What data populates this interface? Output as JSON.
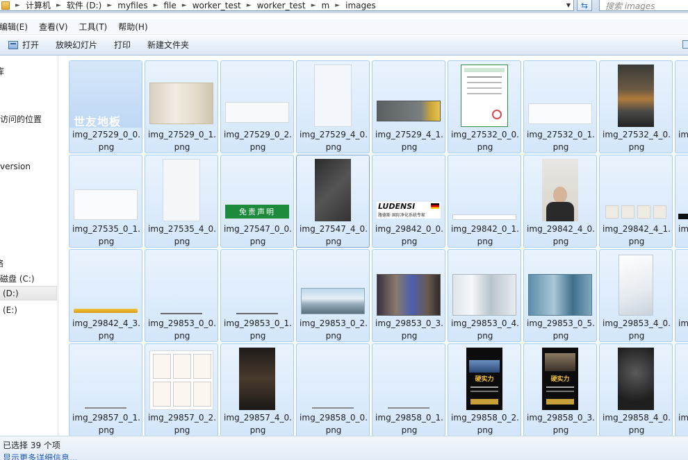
{
  "address_bar": {
    "crumbs": [
      "计算机",
      "软件 (D:)",
      "myfiles",
      "file",
      "worker_test",
      "worker_test",
      "m",
      "images"
    ],
    "search_placeholder": "搜索 images"
  },
  "menu": [
    "编辑(E)",
    "查看(V)",
    "工具(T)",
    "帮助(H)"
  ],
  "toolbar": [
    "打开",
    "放映幻灯片",
    "打印",
    "新建文件夹"
  ],
  "nav": {
    "items": [
      "库",
      "访问的位置",
      "version",
      "络",
      "磁盘 (C:)",
      "(D:)",
      "(E:)"
    ]
  },
  "files": [
    [
      "img_27529_0_0.\npng",
      "img_27529_0_1.\npng",
      "img_27529_0_2.\npng",
      "img_27529_4_0.\npng",
      "img_27529_4_1.\npng",
      "img_27532_0_0.\npng",
      "img_27532_0_1.\npng",
      "img_27532_4_0.\npng",
      "im"
    ],
    [
      "img_27535_0_1.\npng",
      "img_27535_4_0.\npng",
      "img_27547_0_0.\npng",
      "img_27547_4_0.\npng",
      "img_29842_0_0.\npng",
      "img_29842_0_1.\npng",
      "img_29842_4_0.\npng",
      "img_29842_4_1.\npng",
      "im"
    ],
    [
      "img_29842_4_3.\npng",
      "img_29853_0_0.\npng",
      "img_29853_0_1.\npng",
      "img_29853_0_2.\npng",
      "img_29853_0_3.\npng",
      "img_29853_0_4.\npng",
      "img_29853_0_5.\npng",
      "img_29853_4_0.\npng",
      "im"
    ],
    [
      "img_29857_0_1.\npng",
      "img_29857_0_2.\npng",
      "img_29857_4_0.\npng",
      "img_29858_0_0.\npng",
      "img_29858_0_1.\npng",
      "img_29858_0_2.\npng",
      "img_29858_0_3.\npng",
      "img_29858_4_0.\npng",
      "im"
    ]
  ],
  "thumb_text": {
    "logo_27529": "世友地板",
    "banner_27547": "免责声明",
    "ludensi": "LUDENSI",
    "ludensi_sub": "路德斯 国际净化系统专家",
    "poster_title": "硬实力"
  },
  "status": {
    "selected": "已选择 39 个项",
    "details": "显示更多详细信息..."
  }
}
